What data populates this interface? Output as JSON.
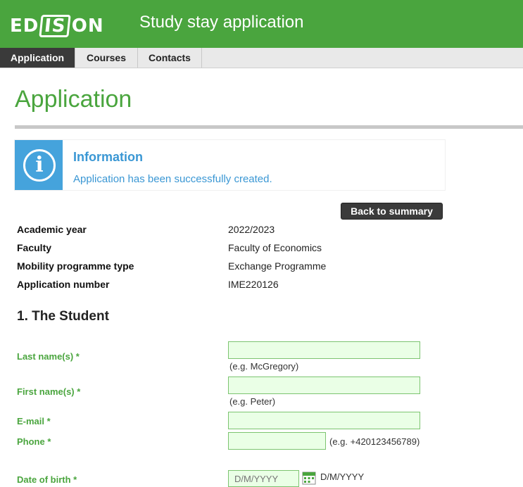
{
  "header": {
    "logo": "EDISON",
    "logo_parts": [
      "ED",
      "IS",
      "ON"
    ],
    "title": "Study stay application"
  },
  "tabs": [
    {
      "label": "Application",
      "active": true
    },
    {
      "label": "Courses",
      "active": false
    },
    {
      "label": "Contacts",
      "active": false
    }
  ],
  "page": {
    "title": "Application"
  },
  "info": {
    "icon": "info-icon",
    "heading": "Information",
    "message": "Application has been successfully created."
  },
  "actions": {
    "back_label": "Back to summary"
  },
  "meta": [
    {
      "label": "Academic year",
      "value": "2022/2023"
    },
    {
      "label": "Faculty",
      "value": "Faculty of Economics"
    },
    {
      "label": "Mobility programme type",
      "value": "Exchange Programme"
    },
    {
      "label": "Application number",
      "value": "IME220126"
    }
  ],
  "student": {
    "section_title": "1. The Student",
    "last_name": {
      "label": "Last name(s) *",
      "value": "",
      "hint": "(e.g. McGregory)"
    },
    "first_name": {
      "label": "First name(s) *",
      "value": "",
      "hint": "(e.g. Peter)"
    },
    "email": {
      "label": "E-mail *",
      "value": ""
    },
    "phone": {
      "label": "Phone *",
      "value": "",
      "hint": "(e.g. +420123456789)"
    },
    "dob": {
      "label": "Date of birth *",
      "placeholder": "D/M/YYYY",
      "format": "D/M/YYYY",
      "icon": "calendar-icon"
    }
  },
  "colors": {
    "brand_green": "#4aa53e",
    "info_blue": "#45a3dc",
    "input_bg": "#eaffe6"
  }
}
